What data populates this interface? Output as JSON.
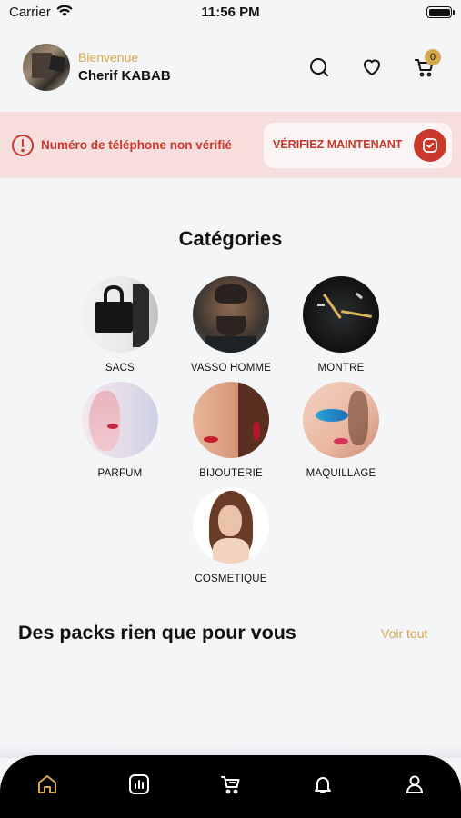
{
  "status_bar": {
    "carrier": "Carrier",
    "time": "11:56 PM"
  },
  "header": {
    "greeting": "Bienvenue",
    "user_name": "Cherif KABAB",
    "cart_count": "0"
  },
  "alert": {
    "message": "Numéro de téléphone non vérifié",
    "button_label": "VÉRIFIEZ MAINTENANT"
  },
  "categories": {
    "title": "Catégories",
    "items": [
      {
        "label": "SACS"
      },
      {
        "label": "VASSO HOMME"
      },
      {
        "label": "MONTRE"
      },
      {
        "label": "PARFUM"
      },
      {
        "label": "BIJOUTERIE"
      },
      {
        "label": "MAQUILLAGE"
      },
      {
        "label": "COSMETIQUE"
      }
    ]
  },
  "packs": {
    "title": "Des packs rien que pour vous",
    "see_all": "Voir tout"
  },
  "colors": {
    "accent_gold": "#d4a84f",
    "alert_red": "#c8382b",
    "alert_bg": "#f6dede",
    "nav_bg": "#000000"
  },
  "bottom_nav": {
    "items": [
      "home-icon",
      "stats-icon",
      "cart-icon",
      "bell-icon",
      "user-icon"
    ],
    "active": "home-icon"
  }
}
